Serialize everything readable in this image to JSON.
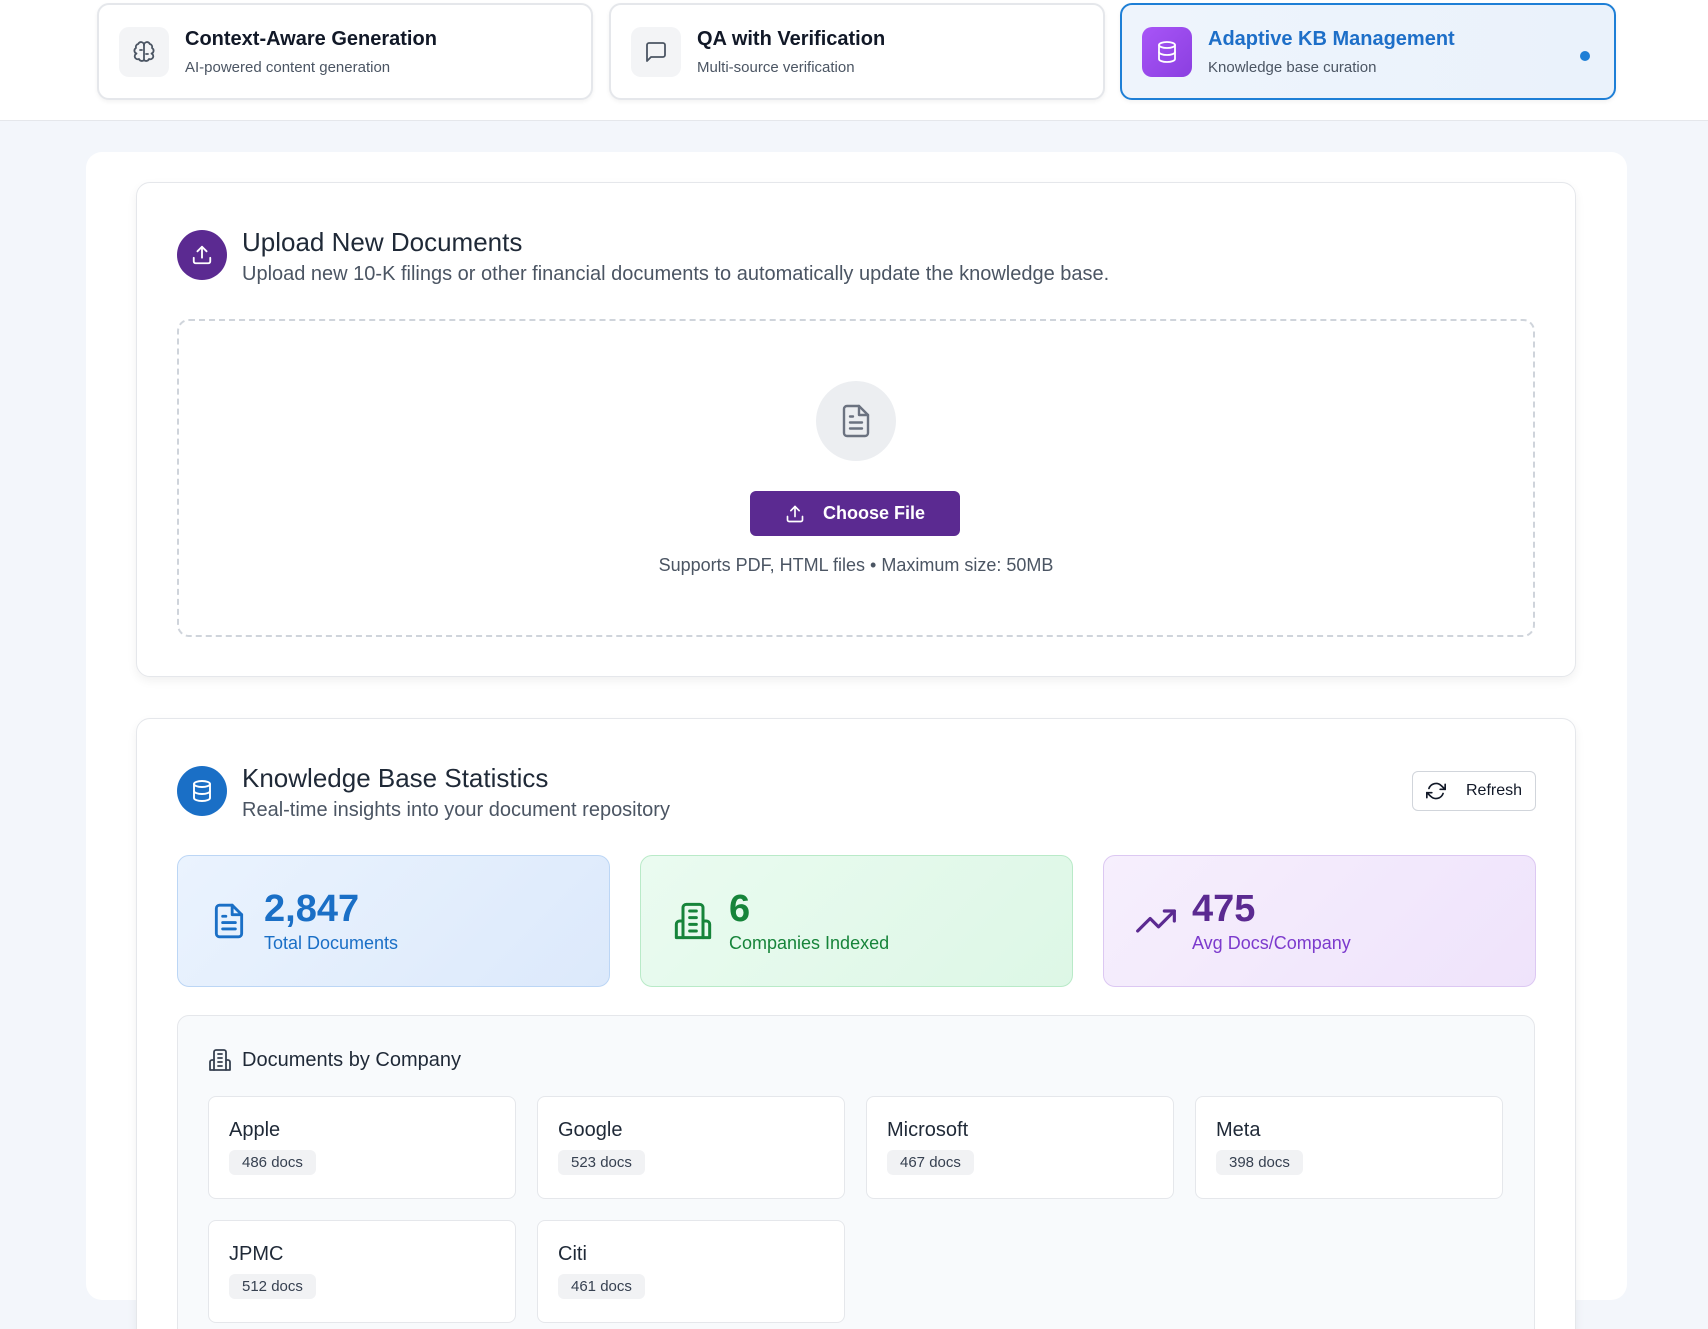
{
  "tabs": [
    {
      "title": "Context-Aware Generation",
      "subtitle": "AI-powered content generation",
      "icon": "brain-icon",
      "active": false
    },
    {
      "title": "QA with Verification",
      "subtitle": "Multi-source verification",
      "icon": "message-square-icon",
      "active": false
    },
    {
      "title": "Adaptive KB Management",
      "subtitle": "Knowledge base curation",
      "icon": "database-icon",
      "active": true
    }
  ],
  "upload": {
    "title": "Upload New Documents",
    "subtitle": "Upload new 10-K filings or other financial documents to automatically update the knowledge base.",
    "button_label": "Choose File",
    "supports_text": "Supports PDF, HTML files • Maximum size: 50MB",
    "icon": "upload-icon"
  },
  "stats": {
    "title": "Knowledge Base Statistics",
    "subtitle": "Real-time insights into your document repository",
    "refresh_label": "Refresh",
    "cards": [
      {
        "value": "2,847",
        "label": "Total Documents",
        "icon": "file-text-icon",
        "color": "#1a6fc6"
      },
      {
        "value": "6",
        "label": "Companies Indexed",
        "icon": "building-icon",
        "color": "#16843a"
      },
      {
        "value": "475",
        "label": "Avg Docs/Company",
        "icon": "trending-up-icon",
        "color": "#5b2a91"
      }
    ]
  },
  "companies": {
    "title": "Documents by Company",
    "items": [
      {
        "name": "Apple",
        "docs": "486 docs"
      },
      {
        "name": "Google",
        "docs": "523 docs"
      },
      {
        "name": "Microsoft",
        "docs": "467 docs"
      },
      {
        "name": "Meta",
        "docs": "398 docs"
      },
      {
        "name": "JPMC",
        "docs": "512 docs"
      },
      {
        "name": "Citi",
        "docs": "461 docs"
      }
    ]
  },
  "colors": {
    "accent_blue": "#1e7fd6",
    "accent_purple": "#5b2a91",
    "active_icon_gradient": "#a855f7"
  }
}
